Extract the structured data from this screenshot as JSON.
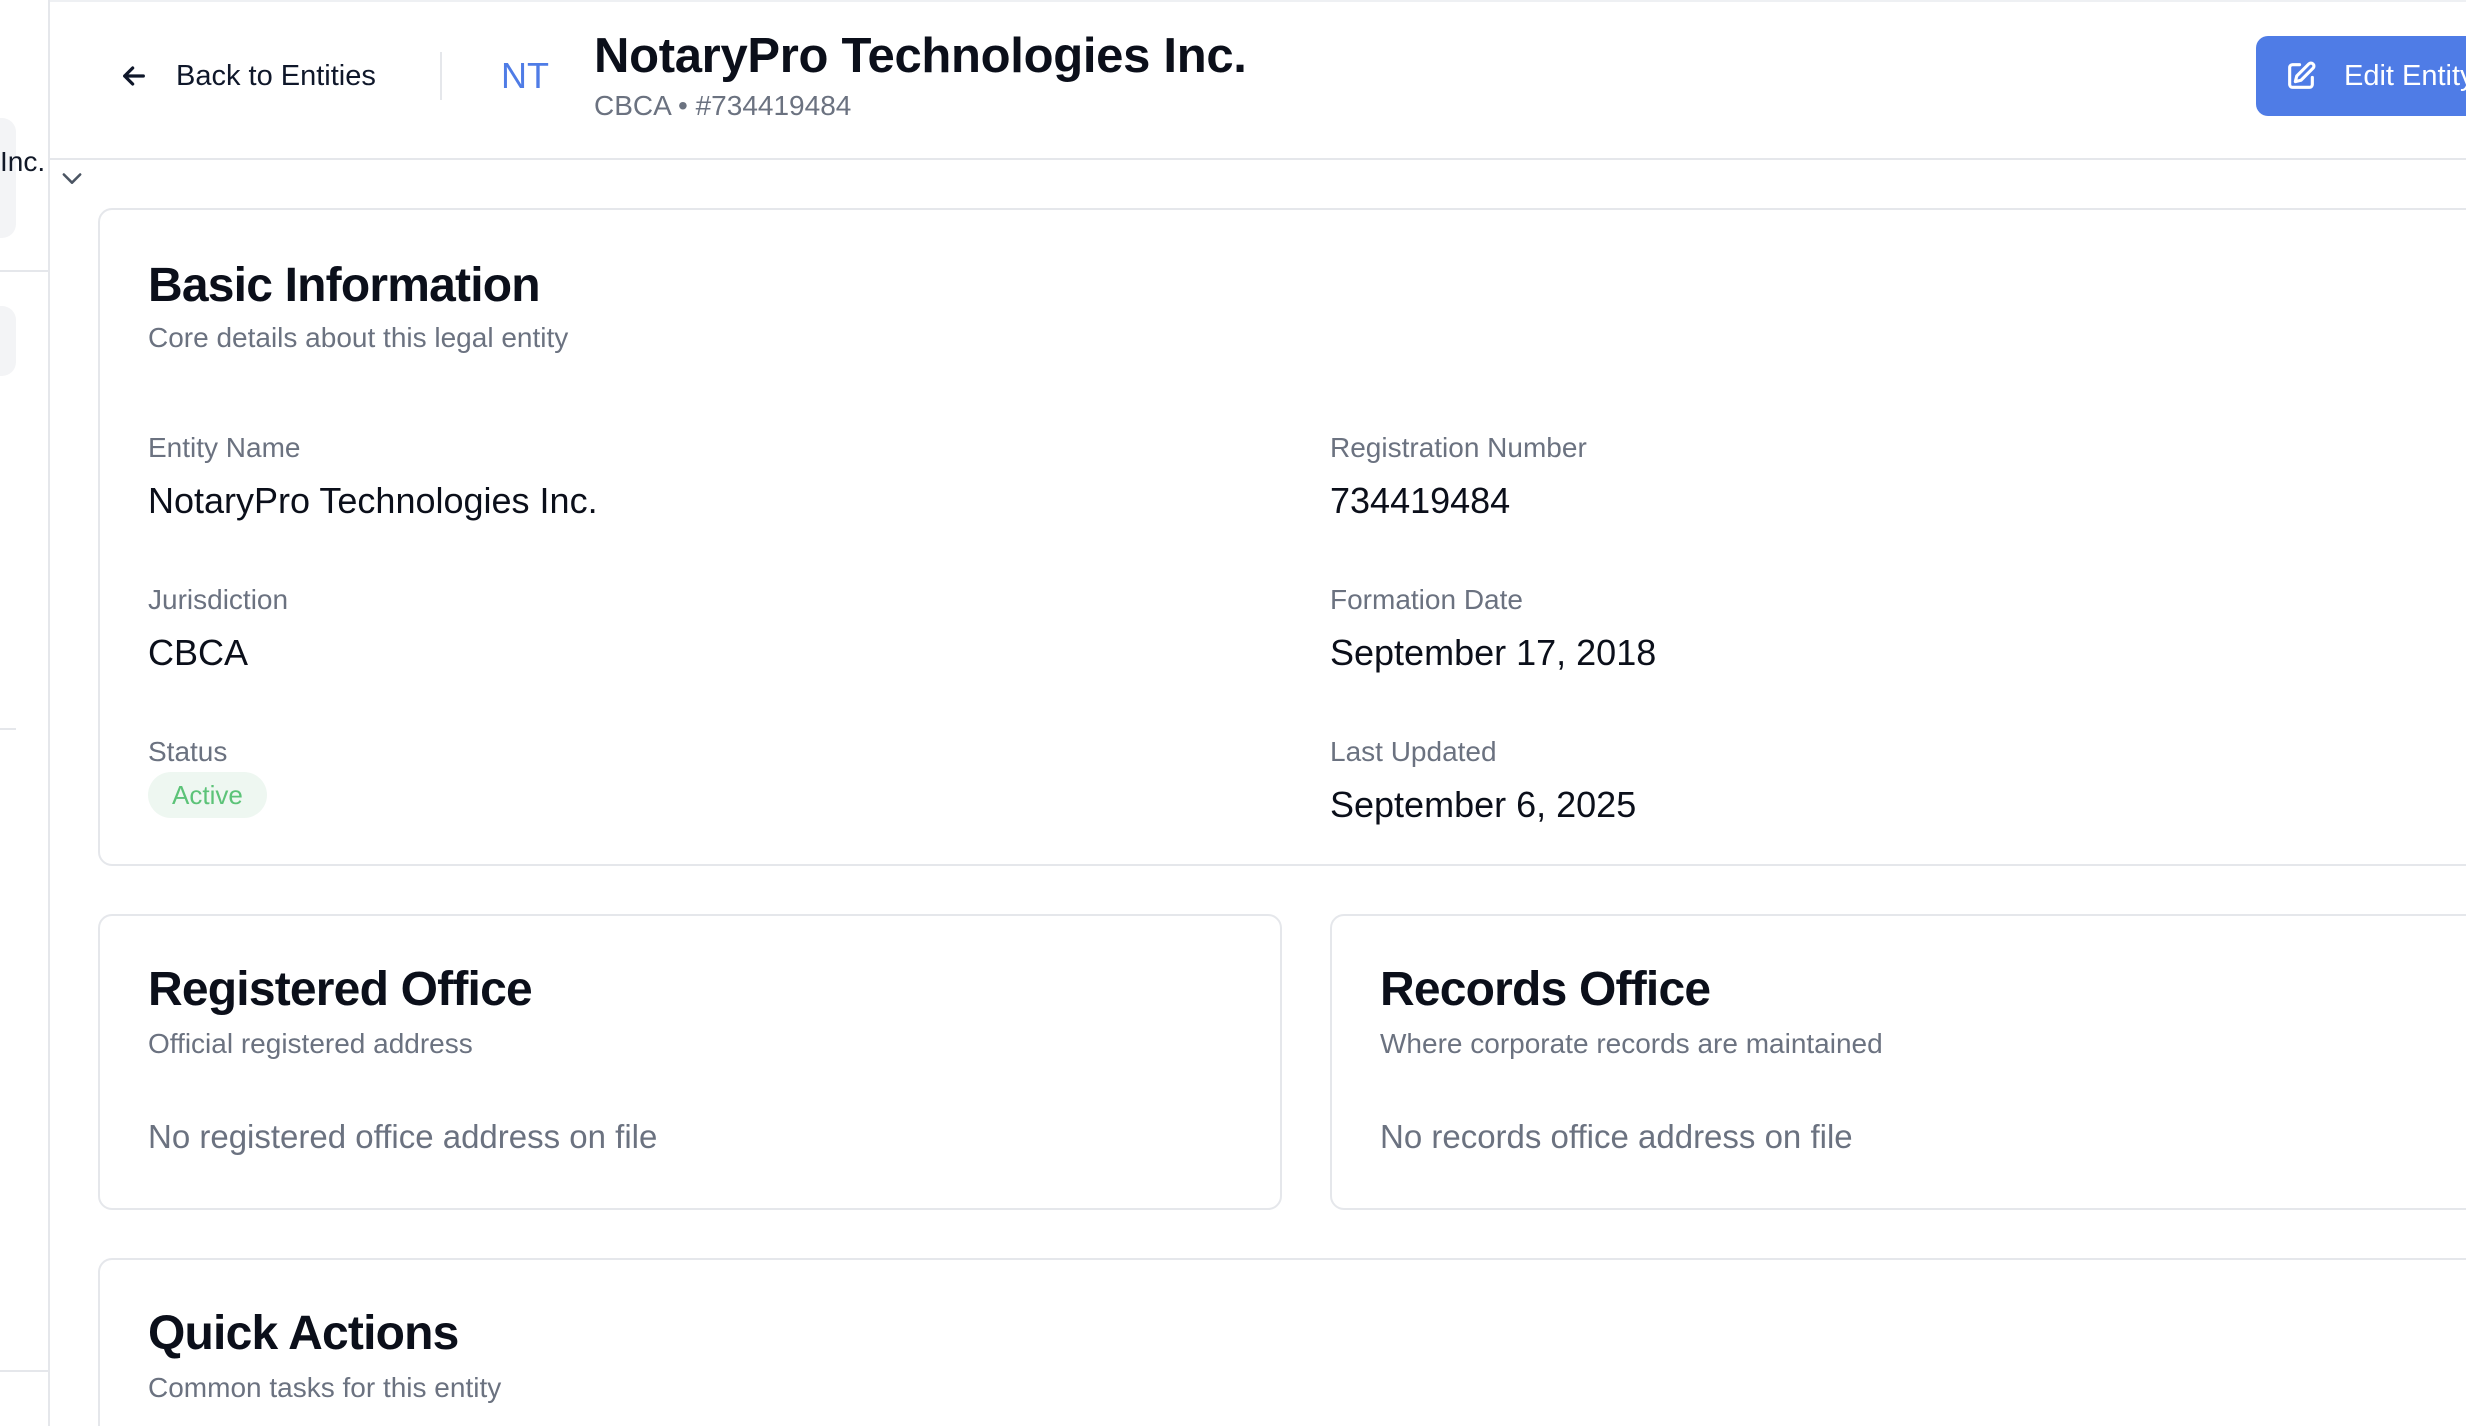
{
  "sidebar": {
    "selected_label": "Inc."
  },
  "header": {
    "back_label": "Back to Entities",
    "avatar_initials": "NT",
    "entity_title": "NotaryPro Technologies Inc.",
    "entity_subtitle": "CBCA • #734419484",
    "edit_button_label": "Edit Entity"
  },
  "basic_info": {
    "title": "Basic Information",
    "description": "Core details about this legal entity",
    "fields": {
      "entity_name": {
        "label": "Entity Name",
        "value": "NotaryPro Technologies Inc."
      },
      "registration_number": {
        "label": "Registration Number",
        "value": "734419484"
      },
      "jurisdiction": {
        "label": "Jurisdiction",
        "value": "CBCA"
      },
      "formation_date": {
        "label": "Formation Date",
        "value": "September 17, 2018"
      },
      "status": {
        "label": "Status",
        "value": "Active"
      },
      "last_updated": {
        "label": "Last Updated",
        "value": "September 6, 2025"
      }
    }
  },
  "registered_office": {
    "title": "Registered Office",
    "description": "Official registered address",
    "empty_text": "No registered office address on file"
  },
  "records_office": {
    "title": "Records Office",
    "description": "Where corporate records are maintained",
    "empty_text": "No records office address on file"
  },
  "quick_actions": {
    "title": "Quick Actions",
    "description": "Common tasks for this entity"
  },
  "colors": {
    "accent": "#4f7ce6",
    "status_active_text": "#5cc378",
    "status_active_bg": "#eef7f1",
    "muted_text": "#6b7280",
    "border": "#e5e7eb"
  },
  "icons": {
    "back": "arrow-left-icon",
    "edit": "edit-icon",
    "collapse": "chevron-down-icon"
  }
}
